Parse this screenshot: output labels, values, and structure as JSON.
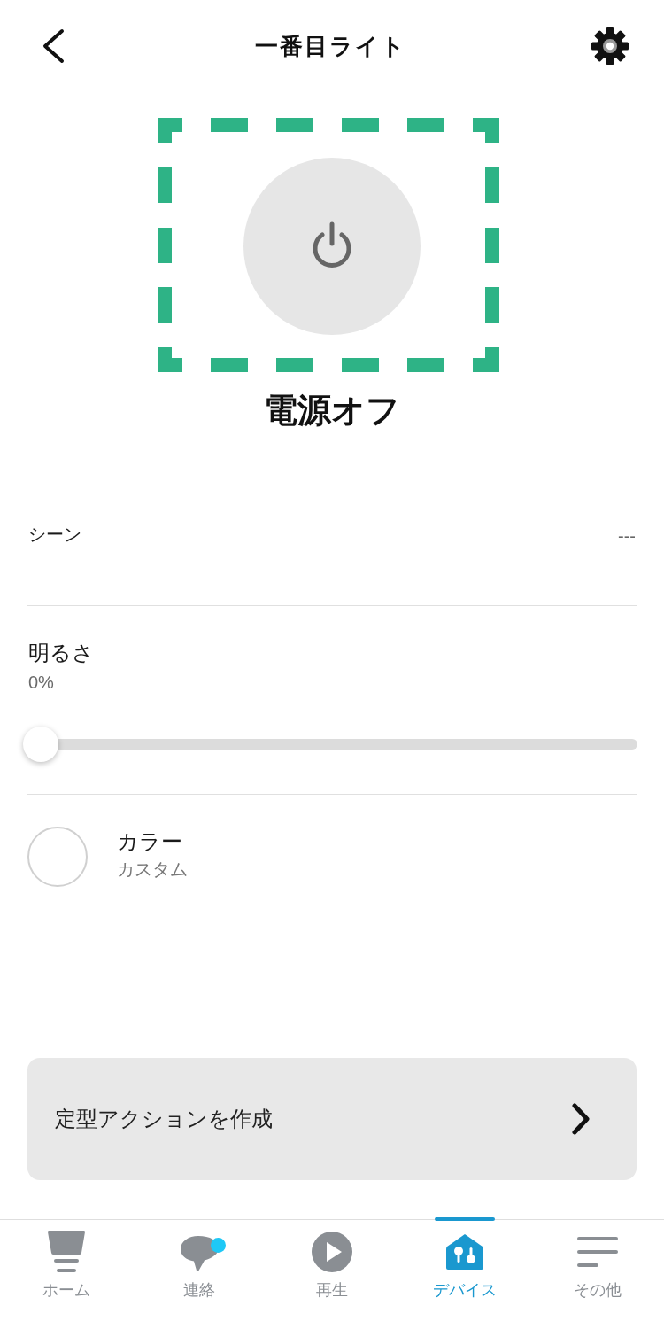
{
  "header": {
    "title": "一番目ライト"
  },
  "power": {
    "on": false,
    "label": "電源オフ"
  },
  "scene": {
    "label": "シーン",
    "value": "---"
  },
  "brightness": {
    "label": "明るさ",
    "reading": "0%",
    "level": 0
  },
  "color": {
    "label": "カラー",
    "value": "カスタム"
  },
  "routine_button": {
    "label": "定型アクションを作成"
  },
  "tab_bar": [
    {
      "kind": "home",
      "label": "ホーム",
      "selected": false,
      "badge": false
    },
    {
      "kind": "chat",
      "label": "連絡",
      "selected": false,
      "badge": true
    },
    {
      "kind": "play",
      "label": "再生",
      "selected": false,
      "badge": false
    },
    {
      "kind": "devices",
      "label": "デバイス",
      "selected": true,
      "badge": false
    },
    {
      "kind": "more",
      "label": "その他",
      "selected": false,
      "badge": false
    }
  ]
}
